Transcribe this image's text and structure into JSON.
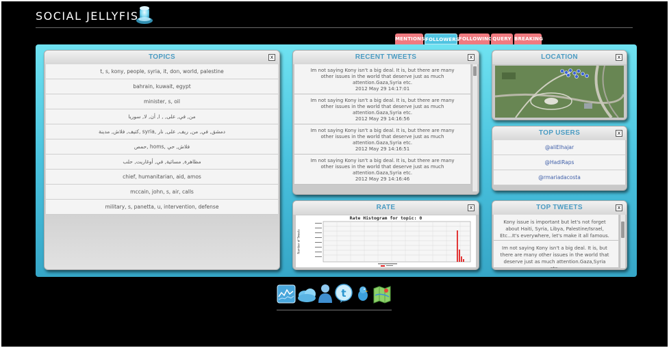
{
  "app": {
    "title": "SOCIAL JELLYFISH"
  },
  "tabs": [
    {
      "label": "MENTIONS",
      "selected": false
    },
    {
      "label": "FOLLOWERS",
      "selected": true
    },
    {
      "label": "FOLLOWING",
      "selected": false
    },
    {
      "label": "QUERY",
      "selected": false
    },
    {
      "label": "BREAKING",
      "selected": false
    }
  ],
  "topics": {
    "title": "TOPICS",
    "close": "x",
    "items": [
      "t, s, kony, people, syria, it, don, world, palestine",
      "bahrain, kuwait, egypt",
      "minister, s, oil",
      "من, في, على, , ا, أن, لا, سوريا",
      "كتيف, فلاش, مدينة, syria, دمشق, في, من, ريف, على, نار",
      "حمص, homs, فلاش, حي",
      "مظاهرة, مسائية, في, أوغاريت, حلب",
      "chief, humanitarian, aid, amos",
      "mccain, john, s, air, calls",
      "military, s, panetta, u, intervention, defense"
    ]
  },
  "recent_tweets": {
    "title": "RECENT TWEETS",
    "close": "x",
    "items": [
      {
        "text": "Im not saying Kony isn't a big deal. It is, but there are many other issues in the world that deserve just as much attention.Gaza,Syria etc.",
        "time": "2012 May 29 14:17:01"
      },
      {
        "text": "Im not saying Kony isn't a big deal. It is, but there are many other issues in the world that deserve just as much attention.Gaza,Syria etc.",
        "time": "2012 May 29 14:16:56"
      },
      {
        "text": "Im not saying Kony isn't a big deal. It is, but there are many other issues in the world that deserve just as much attention.Gaza,Syria etc.",
        "time": "2012 May 29 14:16:51"
      },
      {
        "text": "Im not saying Kony isn't a big deal. It is, but there are many other issues in the world that deserve just as much attention.Gaza,Syria etc.",
        "time": "2012 May 29 14:16:46"
      }
    ]
  },
  "location": {
    "title": "LOCATION",
    "close": "x"
  },
  "top_users": {
    "title": "TOP USERS",
    "close": "x",
    "items": [
      "@aliElhajar",
      "@HadiRaps",
      "@rmariadacosta"
    ]
  },
  "rate": {
    "title": "RATE",
    "close": "x",
    "chart_title": "Rate Histogram for topic: 0",
    "ylabel": "Number of Tweets"
  },
  "top_tweets": {
    "title": "TOP TWEETS",
    "close": "x",
    "items": [
      "Kony issue is important but let's not forget about Haiti, Syria, Libya, Palestine/Israel, Etc...It's everywhere, let's make it all famous.",
      "Im not saying Kony isn't a big deal. It is, but there are many other issues in the world that deserve just as much attention.Gaza,Syria etc."
    ]
  },
  "dock": [
    "chart-icon",
    "cloud-icon",
    "user-icon",
    "twitter-icon",
    "bird-icon",
    "map-icon"
  ],
  "colors": {
    "accent": "#4fc4e2",
    "tab_pink": "#f07a80",
    "board": "#49c2de",
    "header_text": "#4a9bc2"
  }
}
